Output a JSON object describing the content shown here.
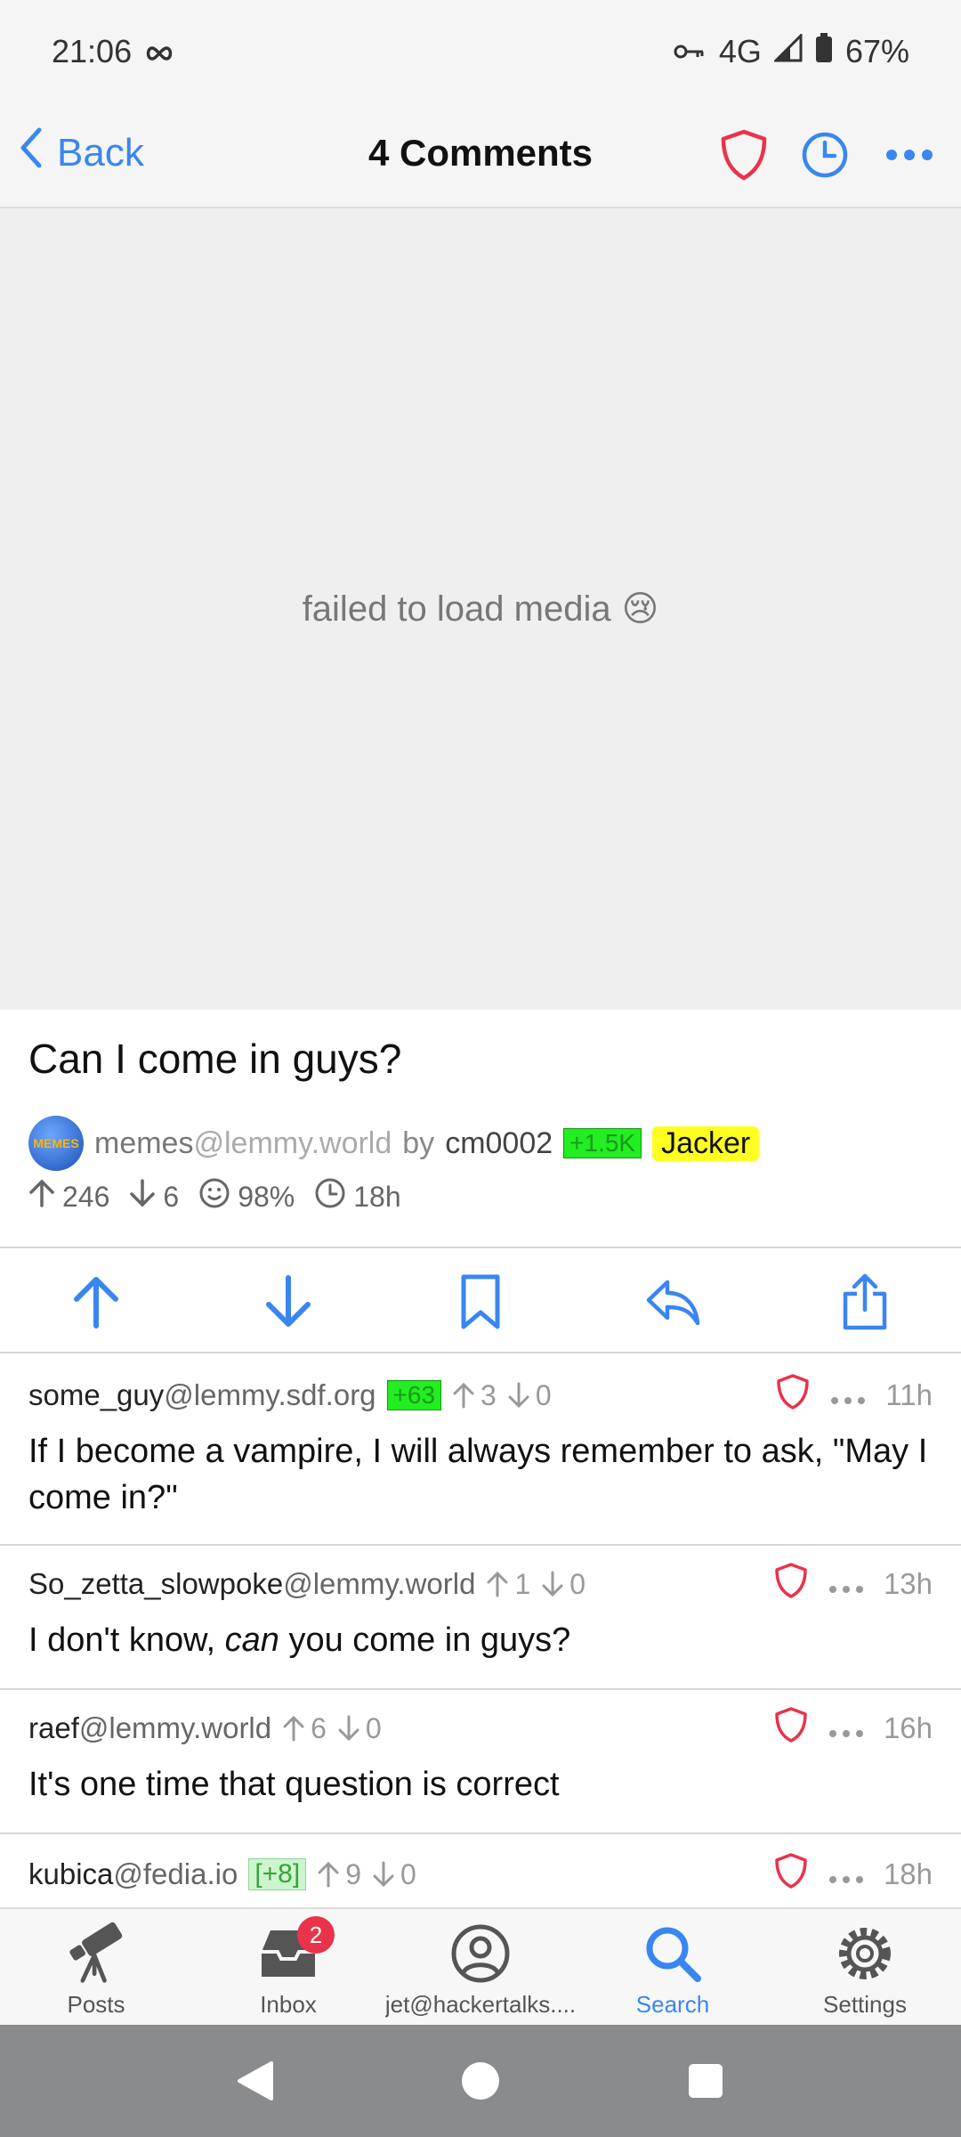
{
  "status_bar": {
    "time": "21:06",
    "network": "4G",
    "battery": "67%"
  },
  "nav": {
    "back_label": "Back",
    "title": "4 Comments"
  },
  "media": {
    "message": "failed to load media",
    "emoji": "😢"
  },
  "post": {
    "title": "Can I come in guys?",
    "community_avatar_text": "MEMES",
    "community": "memes",
    "community_instance": "@lemmy.world",
    "by_label": "by",
    "author": "cm0002",
    "author_score_tag": "+1.5K",
    "author_flair": "Jacker",
    "upvotes": "246",
    "downvotes": "6",
    "ratio": "98%",
    "age": "18h"
  },
  "comments": [
    {
      "user": "some_guy",
      "instance": "@lemmy.sdf.org",
      "tag": "+63",
      "up": "3",
      "down": "0",
      "age": "11h",
      "body_plain": "If I become a vampire, I will always remember to ask, \"May I come in?\""
    },
    {
      "user": "So_zetta_slowpoke",
      "instance": "@lemmy.world",
      "up": "1",
      "down": "0",
      "age": "13h",
      "body_pre": "I don't know, ",
      "body_em": "can",
      "body_post": " you come in guys?"
    },
    {
      "user": "raef",
      "instance": "@lemmy.world",
      "up": "6",
      "down": "0",
      "age": "16h",
      "body_plain": "It's one time that question is correct"
    },
    {
      "user": "kubica",
      "instance": "@fedia.io",
      "tag": "[+8]",
      "up": "9",
      "down": "0",
      "age": "18h"
    }
  ],
  "tabs": [
    {
      "label": "Posts"
    },
    {
      "label": "Inbox",
      "badge": "2"
    },
    {
      "label": "jet@hackertalks...."
    },
    {
      "label": "Search"
    },
    {
      "label": "Settings"
    }
  ],
  "colors": {
    "accent": "#3a86f0",
    "danger": "#e8334a",
    "tag_green": "#22ee22",
    "flair_yellow": "#ffff22"
  }
}
